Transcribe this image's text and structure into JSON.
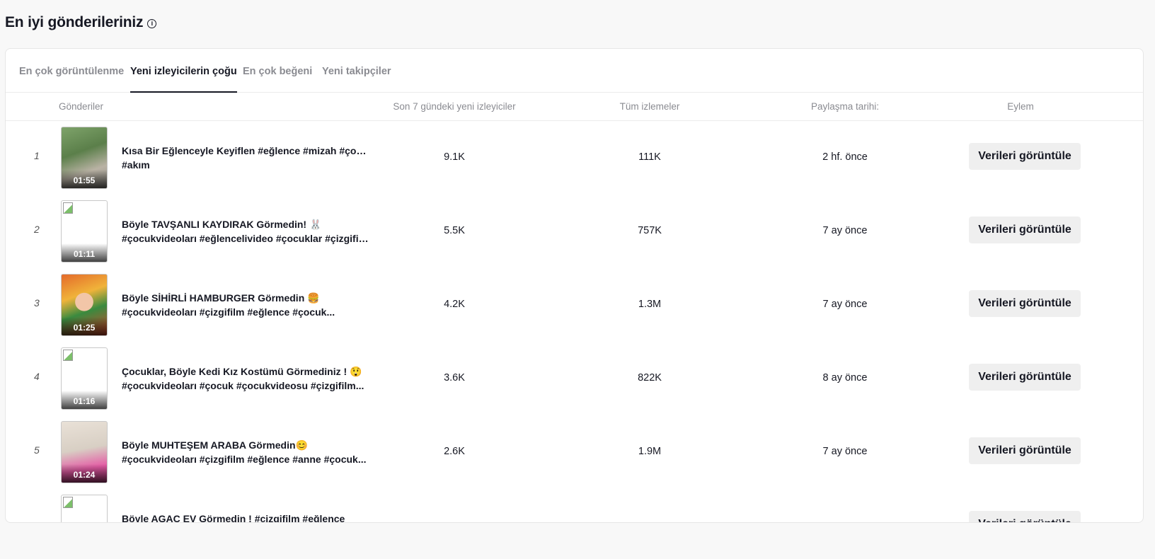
{
  "header": {
    "title": "En iyi gönderileriniz",
    "info_icon": "info-icon"
  },
  "tabs": [
    {
      "label": "En çok görüntülenme",
      "active": false
    },
    {
      "label": "Yeni izleyicilerin çoğu",
      "active": true
    },
    {
      "label": "En çok beğeni",
      "active": false
    },
    {
      "label": "Yeni takipçiler",
      "active": false
    }
  ],
  "columns": {
    "posts": "Gönderiler",
    "new_viewers": "Son 7 gündeki yeni izleyiciler",
    "total_views": "Tüm izlemeler",
    "share_date": "Paylaşma tarihi:",
    "action": "Eylem"
  },
  "rows": [
    {
      "rank": "1",
      "duration": "01:55",
      "desc_line1": "Kısa Bir Eğlenceyle Keyiflen #eğlence #mizah #çocuk",
      "desc_line2": "#akım",
      "new_viewers": "9.1K",
      "total_views": "111K",
      "share_date": "2 hf. önce",
      "action": "Verileri görüntüle"
    },
    {
      "rank": "2",
      "duration": "01:11",
      "desc_line1": "Böyle TAVŞANLI KAYDIRAK Görmedin! 🐰",
      "desc_line2": "#çocukvideoları #eğlencelivideo #çocuklar #çizgifil...",
      "new_viewers": "5.5K",
      "total_views": "757K",
      "share_date": "7 ay önce",
      "action": "Verileri görüntüle"
    },
    {
      "rank": "3",
      "duration": "01:25",
      "desc_line1": "Böyle SİHİRLİ HAMBURGER Görmedin 🍔",
      "desc_line2": "#çocukvideoları #çizgifilm #eğlence #çocuk...",
      "new_viewers": "4.2K",
      "total_views": "1.3M",
      "share_date": "7 ay önce",
      "action": "Verileri görüntüle"
    },
    {
      "rank": "4",
      "duration": "01:16",
      "desc_line1": "Çocuklar, Böyle Kedi Kız Kostümü Görmediniz ! 😲",
      "desc_line2": "#çocukvideoları #çocuk #çocukvideosu #çizgifilm...",
      "new_viewers": "3.6K",
      "total_views": "822K",
      "share_date": "8 ay önce",
      "action": "Verileri görüntüle"
    },
    {
      "rank": "5",
      "duration": "01:24",
      "desc_line1": "Böyle MUHTEŞEM ARABA Görmedin😊",
      "desc_line2": "#çocukvideoları #çizgifilm #eğlence #anne #çocuk...",
      "new_viewers": "2.6K",
      "total_views": "1.9M",
      "share_date": "7 ay önce",
      "action": "Verileri görüntüle"
    },
    {
      "rank": "",
      "duration": "",
      "desc_line1": "Böyle AGAC EV Görmedin ! #cizgifilm #eğlence",
      "desc_line2": "",
      "new_viewers": "",
      "total_views": "",
      "share_date": "",
      "action": "Verileri görüntüle"
    }
  ]
}
